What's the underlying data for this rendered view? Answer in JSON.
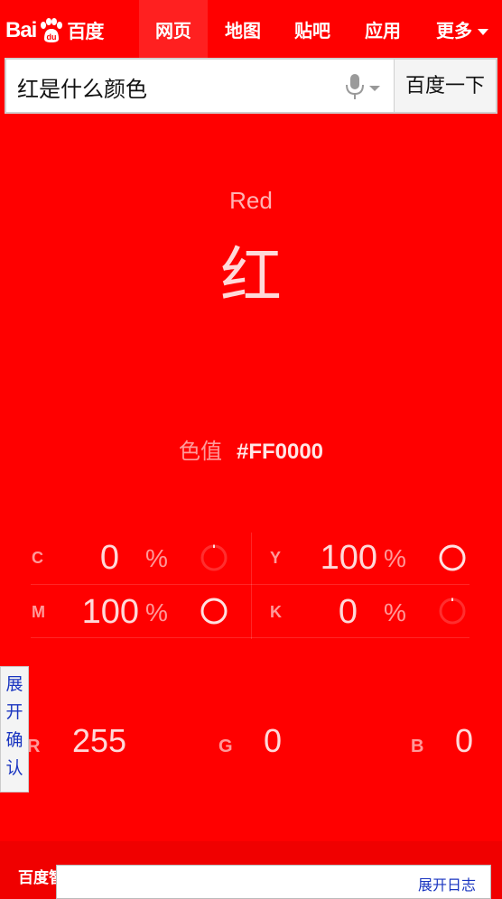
{
  "header": {
    "logo": {
      "bai": "Bai",
      "du": "百度",
      "icon": "paw-icon"
    },
    "nav": [
      {
        "label": "网页",
        "active": true
      },
      {
        "label": "地图",
        "active": false
      },
      {
        "label": "贴吧",
        "active": false
      },
      {
        "label": "应用",
        "active": false
      },
      {
        "label": "更多",
        "active": false
      }
    ]
  },
  "search": {
    "query": "红是什么颜色",
    "button_label": "百度一下",
    "mic_icon": "microphone-icon"
  },
  "color": {
    "english_name": "Red",
    "chinese_name": "红",
    "hex_label": "色值",
    "hex_value": "#FF0000",
    "background": "#FF0000",
    "cmyk": [
      {
        "label": "C",
        "value": "0",
        "unit": "%",
        "fraction": 0
      },
      {
        "label": "Y",
        "value": "100",
        "unit": "%",
        "fraction": 1
      },
      {
        "label": "M",
        "value": "100",
        "unit": "%",
        "fraction": 1
      },
      {
        "label": "K",
        "value": "0",
        "unit": "%",
        "fraction": 0
      }
    ],
    "rgb": [
      {
        "label": "R",
        "value": "255"
      },
      {
        "label": "G",
        "value": "0"
      },
      {
        "label": "B",
        "value": "0"
      }
    ]
  },
  "side_tab": {
    "chars": [
      "展",
      "开",
      "确",
      "认"
    ]
  },
  "footer": {
    "text": "百度智能云",
    "log_button": "展开日志"
  }
}
